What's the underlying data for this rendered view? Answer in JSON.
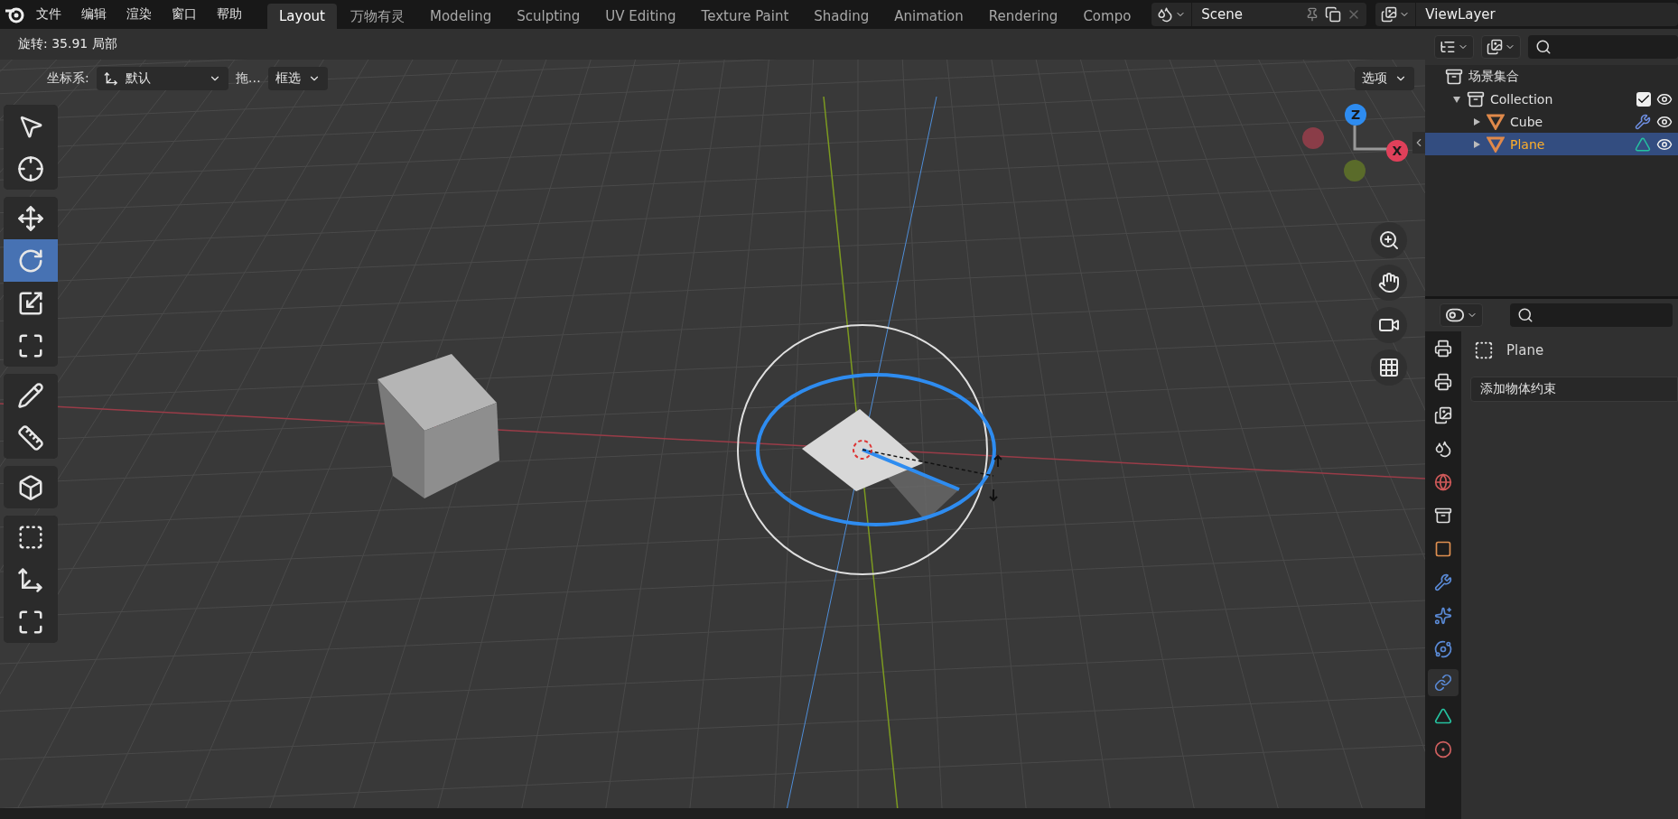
{
  "menu": [
    "文件",
    "编辑",
    "渲染",
    "窗口",
    "帮助"
  ],
  "workspaces": [
    {
      "label": "Layout",
      "selected": true
    },
    {
      "label": "万物有灵",
      "selected": false
    },
    {
      "label": "Modeling",
      "selected": false
    },
    {
      "label": "Sculpting",
      "selected": false
    },
    {
      "label": "UV Editing",
      "selected": false
    },
    {
      "label": "Texture Paint",
      "selected": false
    },
    {
      "label": "Shading",
      "selected": false
    },
    {
      "label": "Animation",
      "selected": false
    },
    {
      "label": "Rendering",
      "selected": false
    },
    {
      "label": "Compo",
      "selected": false
    }
  ],
  "scene": {
    "name": "Scene"
  },
  "view_layer": {
    "name": "ViewLayer"
  },
  "viewport": {
    "operator_status": "旋转: 35.91 局部",
    "orientation_label": "坐标系:",
    "orientation_value": "默认",
    "drag_label": "拖…",
    "drag_value": "框选",
    "options": "选项",
    "tool_groups": [
      [
        {
          "kind": "select",
          "selected": false
        },
        {
          "kind": "cursor",
          "selected": false
        }
      ],
      [
        {
          "kind": "move",
          "selected": false
        },
        {
          "kind": "rotate",
          "selected": true
        },
        {
          "kind": "scale",
          "selected": false
        },
        {
          "kind": "transform",
          "selected": false
        }
      ],
      [
        {
          "kind": "annotate",
          "selected": false
        },
        {
          "kind": "measure",
          "selected": false
        }
      ],
      [
        {
          "kind": "add_cube",
          "selected": false
        }
      ],
      [
        {
          "kind": "bounds",
          "selected": false
        },
        {
          "kind": "select_move",
          "selected": false
        },
        {
          "kind": "transform",
          "selected": false
        }
      ]
    ],
    "gizmo_axes": [
      "Z",
      "X"
    ]
  },
  "outliner": {
    "root": "场景集合",
    "children": [
      {
        "name": "Collection",
        "checked": true,
        "expanded": true,
        "selected": false,
        "children": [
          {
            "name": "Cube",
            "expanded": false,
            "selected": false,
            "kind": "modifier"
          },
          {
            "name": "Plane",
            "expanded": false,
            "selected": true,
            "kind": "mesh"
          }
        ]
      }
    ]
  },
  "properties": {
    "object_name": "Plane",
    "add_button": "添加物体约束",
    "tabs": [
      {
        "kind": "render",
        "selected": false
      },
      {
        "kind": "output",
        "selected": false
      },
      {
        "kind": "view_layer",
        "selected": false
      },
      {
        "kind": "scene",
        "selected": false
      },
      {
        "kind": "world",
        "selected": false
      },
      {
        "kind": "collection",
        "selected": false
      },
      {
        "kind": "object",
        "selected": false
      },
      {
        "kind": "modifiers",
        "selected": false
      },
      {
        "kind": "particles",
        "selected": false
      },
      {
        "kind": "physics",
        "selected": false
      },
      {
        "kind": "constraints",
        "selected": true
      },
      {
        "kind": "data",
        "selected": false
      },
      {
        "kind": "material",
        "selected": false
      }
    ]
  }
}
